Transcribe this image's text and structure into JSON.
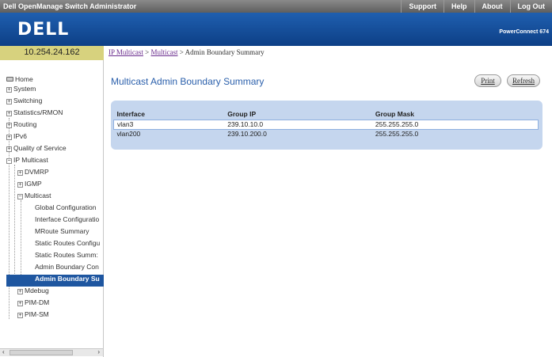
{
  "topbar": {
    "title": "Dell OpenManage Switch Administrator",
    "links": [
      "Support",
      "Help",
      "About",
      "Log Out"
    ]
  },
  "brand": {
    "logo": "DELL",
    "product": "PowerConnect 674"
  },
  "nav": {
    "ip": "10.254.24.162",
    "items": [
      {
        "label": "Home",
        "icon": "home-icon"
      },
      {
        "label": "System"
      },
      {
        "label": "Switching"
      },
      {
        "label": "Statistics/RMON"
      },
      {
        "label": "Routing"
      },
      {
        "label": "IPv6"
      },
      {
        "label": "Quality of Service"
      },
      {
        "label": "IP Multicast"
      },
      {
        "label": "DVMRP"
      },
      {
        "label": "IGMP"
      },
      {
        "label": "Multicast"
      },
      {
        "label": "Global Configuration"
      },
      {
        "label": "Interface Configuratio"
      },
      {
        "label": "MRoute Summary"
      },
      {
        "label": "Static Routes Configu"
      },
      {
        "label": "Static Routes Summ:"
      },
      {
        "label": "Admin Boundary Con"
      },
      {
        "label": "Admin Boundary Su"
      },
      {
        "label": "Mdebug"
      },
      {
        "label": "PIM-DM"
      },
      {
        "label": "PIM-SM"
      }
    ]
  },
  "breadcrumb": {
    "link1": "IP Multicast",
    "sep1": " > ",
    "link2": "Multicast",
    "sep2": " > ",
    "current": "Admin Boundary Summary"
  },
  "page": {
    "title": "Multicast Admin Boundary Summary",
    "print_label": "Print",
    "refresh_label": "Refresh"
  },
  "table": {
    "headers": [
      "Interface",
      "Group IP",
      "Group Mask"
    ],
    "rows": [
      [
        "vlan3",
        "239.10.10.0",
        "255.255.255.0"
      ],
      [
        "vlan200",
        "239.10.200.0",
        "255.255.255.0"
      ]
    ]
  },
  "colors": {
    "brand_blue": "#1e56a0",
    "title_blue": "#2a5fab",
    "ip_box": "#d7d27e",
    "table_bg": "#c5d6ee"
  }
}
